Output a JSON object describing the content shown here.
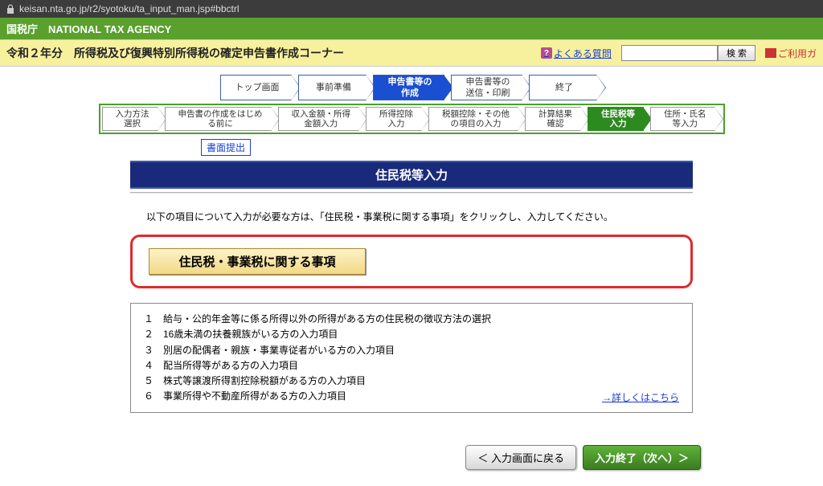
{
  "url": "keisan.nta.go.jp/r2/syotoku/ta_input_man.jsp#bbctrl",
  "agency": "国税庁　NATIONAL TAX AGENCY",
  "page_title": "令和２年分　所得税及び復興特別所得税の確定申告書作成コーナー",
  "faq_label": "よくある質問",
  "search_button": "検 索",
  "guide_label": "ご利用ガ",
  "breadcrumb_main": [
    "トップ画面",
    "事前準備",
    "申告書等の\n作成",
    "申告書等の\n送信・印刷",
    "終了"
  ],
  "breadcrumb_main_active": 2,
  "breadcrumb_sub": [
    "入力方法\n選択",
    "申告書の作成をはじめ\nる前に",
    "収入金額・所得\n金額入力",
    "所得控除\n入力",
    "税額控除・その他\nの項目の入力",
    "計算結果\n確認",
    "住民税等\n入力",
    "住所・氏名\n等入力"
  ],
  "breadcrumb_sub_active": 6,
  "submit_link": "書面提出",
  "section_title": "住民税等入力",
  "instruction": "以下の項目について入力が必要な方は、「住民税・事業税に関する事項」をクリックし、入力してください。",
  "main_button": "住民税・事業税に関する事項",
  "info_list": [
    "１　給与・公的年金等に係る所得以外の所得がある方の住民税の徴収方法の選択",
    "２　16歳未満の扶養親族がいる方の入力項目",
    "３　別居の配偶者・親族・事業専従者がいる方の入力項目",
    "４　配当所得等がある方の入力項目",
    "５　株式等譲渡所得割控除税額がある方の入力項目",
    "６　事業所得や不動産所得がある方の入力項目"
  ],
  "detail_link": "→詳しくはこちら",
  "back_button": "＜ 入力画面に戻る",
  "next_button": "入力終了（次へ）＞"
}
